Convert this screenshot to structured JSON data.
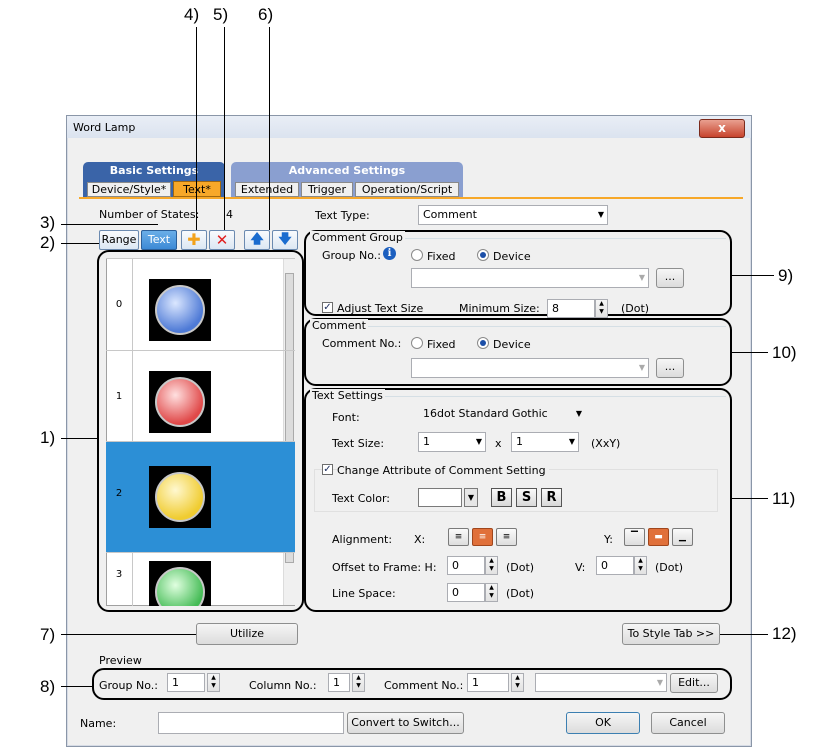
{
  "callouts": {
    "c1": "1)",
    "c2": "2)",
    "c3": "3)",
    "c4": "4)",
    "c5": "5)",
    "c6": "6)",
    "c7": "7)",
    "c8": "8)",
    "c9": "9)",
    "c10": "10)",
    "c11": "11)",
    "c12": "12)"
  },
  "window": {
    "title": "Word Lamp",
    "close": "x"
  },
  "tabs": {
    "basic": "Basic Settings",
    "advanced": "Advanced Settings",
    "device_style": "Device/Style*",
    "text": "Text*",
    "extended": "Extended",
    "trigger": "Trigger",
    "operation_script": "Operation/Script"
  },
  "states": {
    "label": "Number of States:",
    "count": "4",
    "range_btn": "Range",
    "text_btn": "Text",
    "rows": [
      {
        "num": "0",
        "color": "blue"
      },
      {
        "num": "1",
        "color": "red"
      },
      {
        "num": "2",
        "color": "yellow"
      },
      {
        "num": "3",
        "color": "green"
      }
    ],
    "selected_row": "2"
  },
  "text_type": {
    "label": "Text Type:",
    "value": "Comment"
  },
  "comment_group": {
    "title": "Comment Group",
    "group_no": "Group No.:",
    "fixed": "Fixed",
    "device": "Device",
    "browse": "...",
    "adjust_text_size": "Adjust Text Size",
    "minimum_size_label": "Minimum Size:",
    "minimum_size": "8",
    "dot": "(Dot)"
  },
  "comment": {
    "title": "Comment",
    "comment_no": "Comment No.:",
    "fixed": "Fixed",
    "device": "Device",
    "browse": "..."
  },
  "text_settings": {
    "title": "Text Settings",
    "font_label": "Font:",
    "font_value": "16dot Standard Gothic",
    "size_label": "Text Size:",
    "size_x": "1",
    "x": "x",
    "size_y": "1",
    "xxy": "(XxY)",
    "change_attr": "Change Attribute of Comment Setting",
    "color_label": "Text Color:",
    "bold": "B",
    "shadow": "S",
    "raised": "R",
    "alignment": "Alignment:",
    "x_label": "X:",
    "y_label": "Y:",
    "offset_label": "Offset to Frame: H:",
    "offset_h": "0",
    "dot_h": "(Dot)",
    "v_label": "V:",
    "offset_v": "0",
    "dot_v": "(Dot)",
    "line_space_label": "Line Space:",
    "line_space": "0",
    "dot_l": "(Dot)"
  },
  "utilize": "Utilize",
  "to_style_tab": "To Style Tab >>",
  "preview": {
    "title": "Preview",
    "group_label": "Group No.:",
    "group_value": "1",
    "column_label": "Column No.:",
    "column_value": "1",
    "comment_label": "Comment No.:",
    "comment_value": "1",
    "edit": "Edit..."
  },
  "footer": {
    "name_label": "Name:",
    "convert": "Convert to Switch...",
    "ok": "OK",
    "cancel": "Cancel"
  }
}
